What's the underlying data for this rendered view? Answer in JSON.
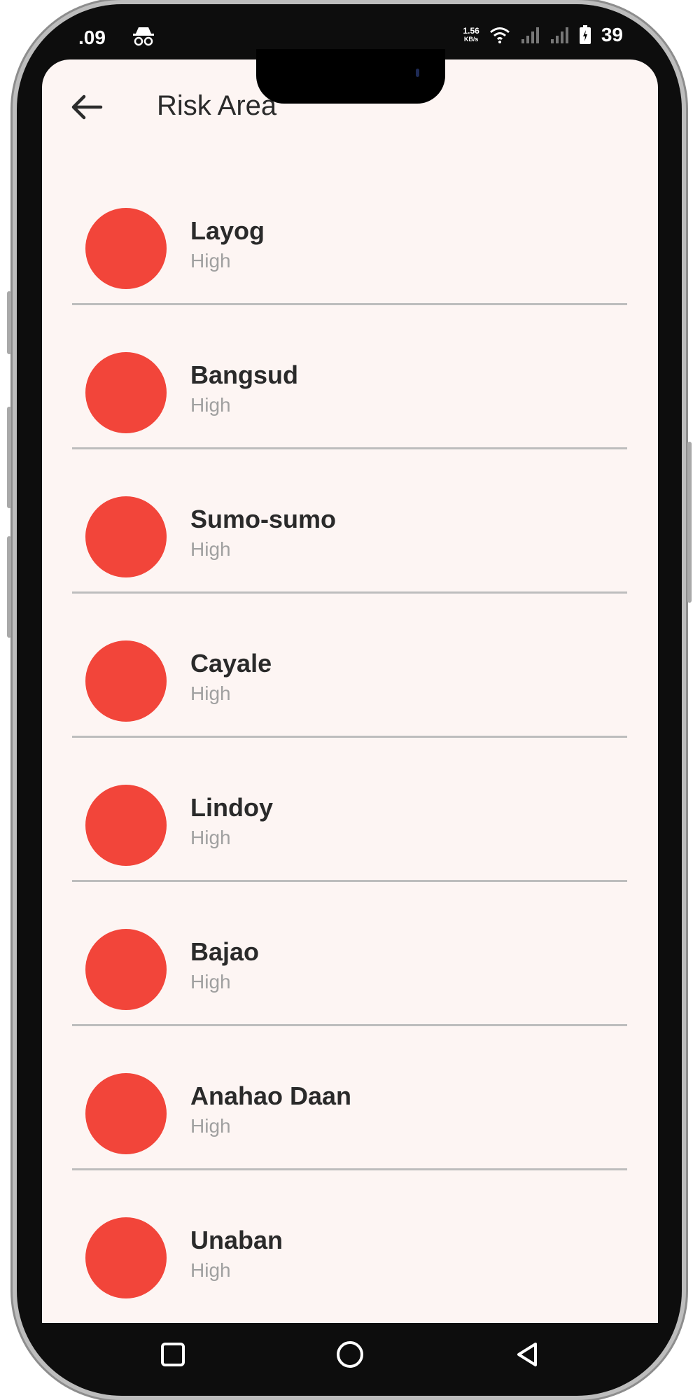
{
  "status_bar": {
    "time": ".09",
    "net_speed_value": "1.56",
    "net_speed_unit": "KB/s",
    "battery": "39",
    "icons": [
      "incognito-icon",
      "wifi-icon",
      "signal-icon",
      "signal-icon",
      "battery-icon"
    ]
  },
  "app_bar": {
    "title": "Risk Area",
    "back_icon": "arrow-left-icon"
  },
  "colors": {
    "risk_high": "#f2453a",
    "background": "#fdf5f3"
  },
  "risk_areas": [
    {
      "name": "Layog",
      "level": "High"
    },
    {
      "name": "Bangsud",
      "level": "High"
    },
    {
      "name": "Sumo-sumo",
      "level": "High"
    },
    {
      "name": "Cayale",
      "level": "High"
    },
    {
      "name": "Lindoy",
      "level": "High"
    },
    {
      "name": "Bajao",
      "level": "High"
    },
    {
      "name": "Anahao Daan",
      "level": "High"
    },
    {
      "name": "Unaban",
      "level": "High"
    }
  ],
  "nav_bar": {
    "icons": [
      "square-recents-icon",
      "circle-home-icon",
      "triangle-back-icon"
    ]
  }
}
